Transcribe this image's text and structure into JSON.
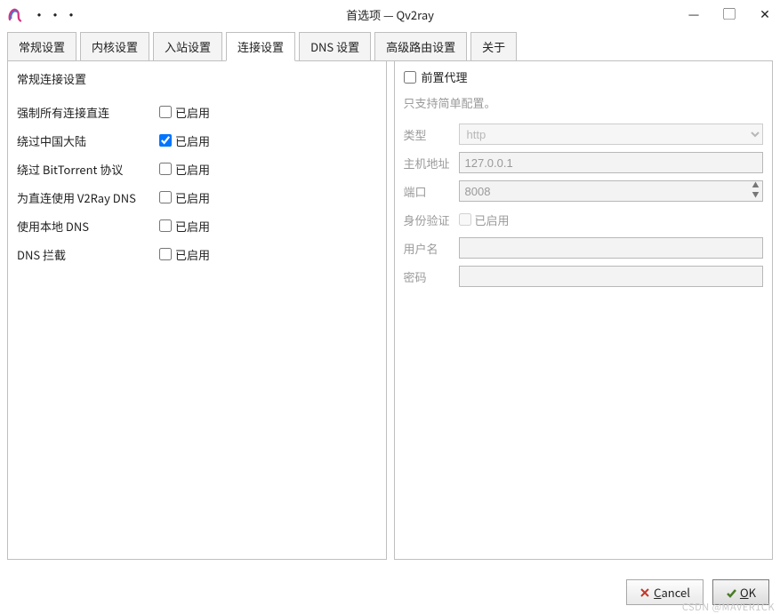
{
  "window": {
    "title": "首选项 — Qv2ray",
    "menu_dots": "•••",
    "min": "—",
    "max": "▢",
    "close": "✕"
  },
  "tabs": [
    {
      "label": "常规设置"
    },
    {
      "label": "内核设置"
    },
    {
      "label": "入站设置"
    },
    {
      "label": "连接设置",
      "active": true
    },
    {
      "label": "DNS 设置"
    },
    {
      "label": "高级路由设置"
    },
    {
      "label": "关于"
    }
  ],
  "left": {
    "title": "常规连接设置",
    "enabled_label": "已启用",
    "items": [
      {
        "label": "强制所有连接直连",
        "checked": false
      },
      {
        "label": "绕过中国大陆",
        "checked": true
      },
      {
        "label": "绕过 BitTorrent 协议",
        "checked": false
      },
      {
        "label": "为直连使用 V2Ray DNS",
        "checked": false
      },
      {
        "label": "使用本地 DNS",
        "checked": false
      },
      {
        "label": "DNS 拦截",
        "checked": false
      }
    ]
  },
  "right": {
    "head_checkbox_label": "前置代理",
    "note": "只支持简单配置。",
    "type_label": "类型",
    "type_value": "http",
    "host_label": "主机地址",
    "host_value": "127.0.0.1",
    "port_label": "端口",
    "port_value": "8008",
    "auth_label": "身份验证",
    "auth_checkbox": "已启用",
    "user_label": "用户名",
    "user_value": "",
    "pass_label": "密码",
    "pass_value": ""
  },
  "buttons": {
    "cancel_pre": "C",
    "cancel_rest": "ancel",
    "ok_pre": "O",
    "ok_rest": "K"
  },
  "watermark": "CSDN @MAVER1CK"
}
